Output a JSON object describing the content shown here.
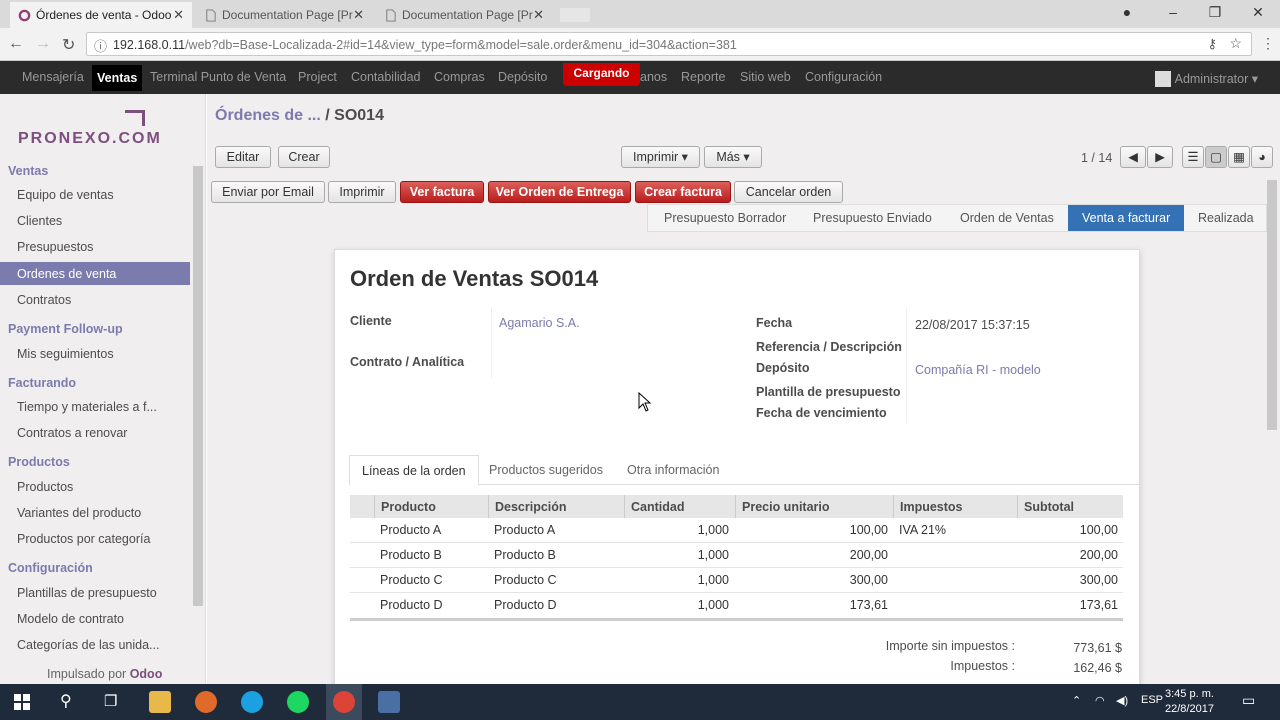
{
  "browser": {
    "tabs": [
      {
        "title": "Órdenes de venta - Odoo"
      },
      {
        "title": "Documentation Page [Pr"
      },
      {
        "title": "Documentation Page [Pr"
      }
    ],
    "url_host": "192.168.0.11",
    "url_path": "/web?db=Base-Localizada-2#id=14&view_type=form&model=sale.order&menu_id=304&action=381"
  },
  "topmenu": {
    "items": [
      "Mensajería",
      "Ventas",
      "Terminal Punto de Venta",
      "Project",
      "Contabilidad",
      "Compras",
      "Depósito",
      "anos",
      "Reporte",
      "Sitio web",
      "Configuración"
    ],
    "loading": "Cargando",
    "user": "Administrator ▾"
  },
  "sidebar": {
    "logo": "PRONEXO.COM",
    "sections": [
      {
        "title": "Ventas",
        "items": [
          "Equipo de ventas",
          "Clientes",
          "Presupuestos",
          "Ordenes de venta",
          "Contratos"
        ]
      },
      {
        "title": "Payment Follow-up",
        "items": [
          "Mis seguimientos"
        ]
      },
      {
        "title": "Facturando",
        "items": [
          "Tiempo y materiales a f...",
          "Contratos a renovar"
        ]
      },
      {
        "title": "Productos",
        "items": [
          "Productos",
          "Variantes del producto",
          "Productos por categoría"
        ]
      },
      {
        "title": "Configuración",
        "items": [
          "Plantillas de presupuesto",
          "Modelo de contrato",
          "Categorías de las unida..."
        ]
      }
    ],
    "powered_prefix": "Impulsado por",
    "powered_brand": "Odoo"
  },
  "breadcrumb": {
    "parent": "Órdenes de ...",
    "current": "/ SO014"
  },
  "toolbar": {
    "edit": "Editar",
    "create": "Crear",
    "print": "Imprimir ▾",
    "more": "Más ▾",
    "pager": "1 / 14"
  },
  "actions": [
    "Enviar por Email",
    "Imprimir",
    "Ver factura",
    "Ver Orden de Entrega",
    "Crear factura",
    "Cancelar orden"
  ],
  "stages": [
    "Presupuesto Borrador",
    "Presupuesto Enviado",
    "Orden de Ventas",
    "Venta a facturar",
    "Realizada"
  ],
  "form": {
    "title": "Orden de Ventas SO014",
    "cliente_label": "Cliente",
    "cliente_value": "Agamario S.A.",
    "contrato_label": "Contrato / Analítica",
    "fecha_label": "Fecha",
    "fecha_value": "22/08/2017 15:37:15",
    "ref_label": "Referencia / Descripción",
    "deposito_label": "Depósito",
    "deposito_value": "Compañía RI - modelo",
    "plantilla_label": "Plantilla de presupuesto",
    "vencimiento_label": "Fecha de vencimiento"
  },
  "notebook": {
    "tabs": [
      "Líneas de la orden",
      "Productos sugeridos",
      "Otra información"
    ]
  },
  "lines": {
    "headers": [
      "Producto",
      "Descripción",
      "Cantidad",
      "Precio unitario",
      "Impuestos",
      "Subtotal"
    ],
    "rows": [
      [
        "Producto A",
        "Producto A",
        "1,000",
        "100,00",
        "IVA 21%",
        "100,00"
      ],
      [
        "Producto B",
        "Producto B",
        "1,000",
        "200,00",
        "",
        "200,00"
      ],
      [
        "Producto C",
        "Producto C",
        "1,000",
        "300,00",
        "",
        "300,00"
      ],
      [
        "Producto D",
        "Producto D",
        "1,000",
        "173,61",
        "",
        "173,61"
      ]
    ]
  },
  "totals": {
    "untaxed_label": "Importe sin impuestos :",
    "untaxed_value": "773,61 $",
    "tax_label": "Impuestos :",
    "tax_value": "162,46 $"
  },
  "taskbar": {
    "lang": "ESP",
    "time": "3:45 p. m.",
    "date": "22/8/2017"
  }
}
